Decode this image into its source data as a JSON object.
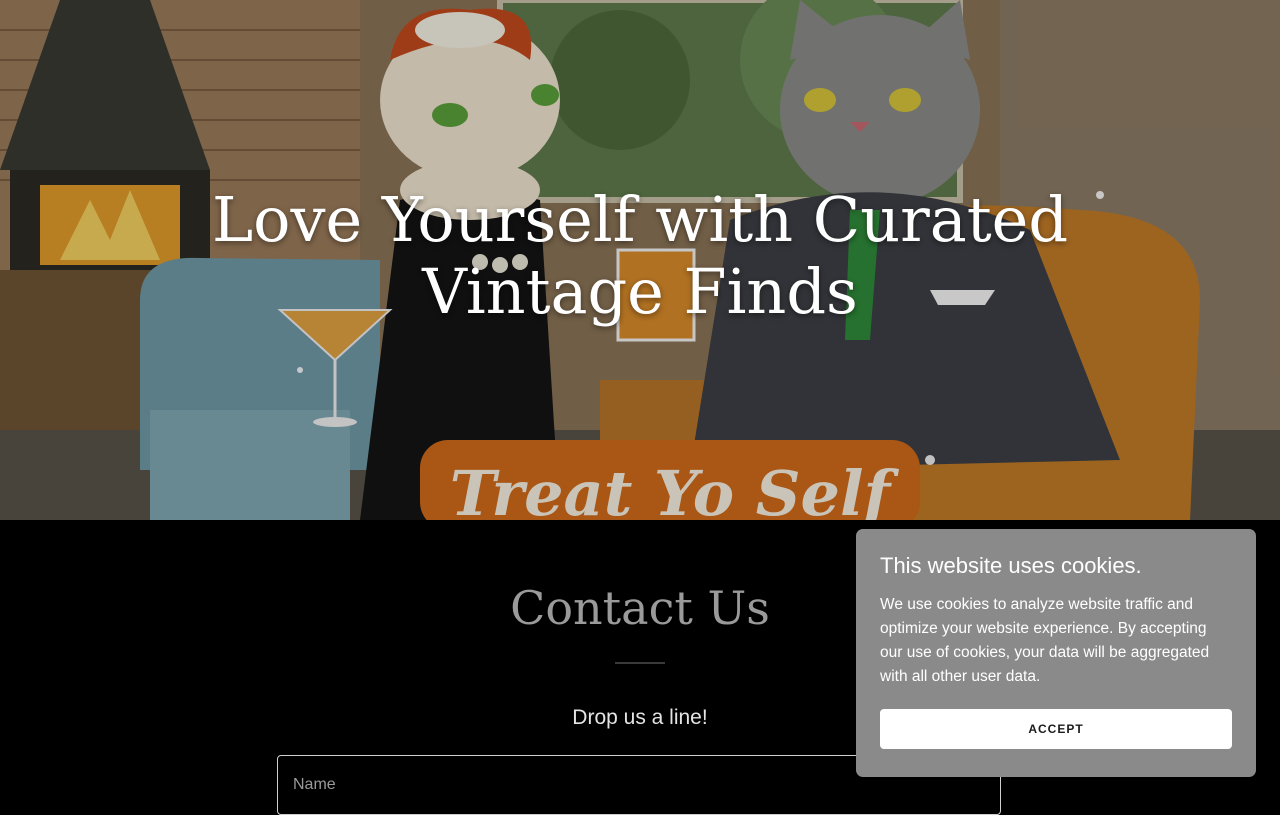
{
  "hero": {
    "title_line1": "Love Yourself with Curated",
    "title_line2": "Vintage Finds",
    "image_alt": "Illustration of two cats in mid-century lounge",
    "image_sign_text": "Treat Yo Self"
  },
  "contact": {
    "title": "Contact Us",
    "subtitle": "Drop us a line!",
    "name_placeholder": "Name"
  },
  "cookie_banner": {
    "title": "This website uses cookies.",
    "text": "We use cookies to analyze website traffic and optimize your website experience. By accepting our use of cookies, your data will be aggregated with all other user data.",
    "accept_label": "ACCEPT"
  },
  "colors": {
    "contact_bg": "#000000",
    "cookie_bg": "#8a8a8a",
    "accent_text": "#9a9a9a"
  }
}
